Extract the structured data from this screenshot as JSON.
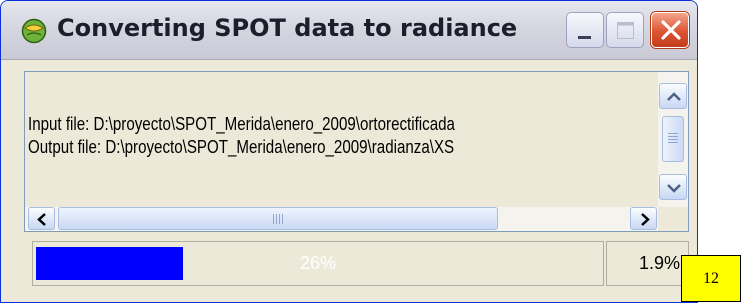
{
  "window": {
    "title": "Converting SPOT data to radiance",
    "icon": "globe-icon"
  },
  "titlebar_buttons": {
    "minimize": "minimize-icon",
    "maximize": "maximize-icon",
    "close": "close-icon"
  },
  "log": {
    "lines": [
      "Input file: D:\\proyecto\\SPOT_Merida\\enero_2009\\ortorectificada",
      "Output file: D:\\proyecto\\SPOT_Merida\\enero_2009\\radianza\\XS"
    ]
  },
  "progress": {
    "label": "26%",
    "value": 0.26,
    "fill_color": "#0000ff"
  },
  "secondary_percent": "1.9%",
  "page_number": "12",
  "colors": {
    "window_bg": "#ece9d8",
    "close_button": "#dc5432",
    "page_box": "#ffff00"
  }
}
